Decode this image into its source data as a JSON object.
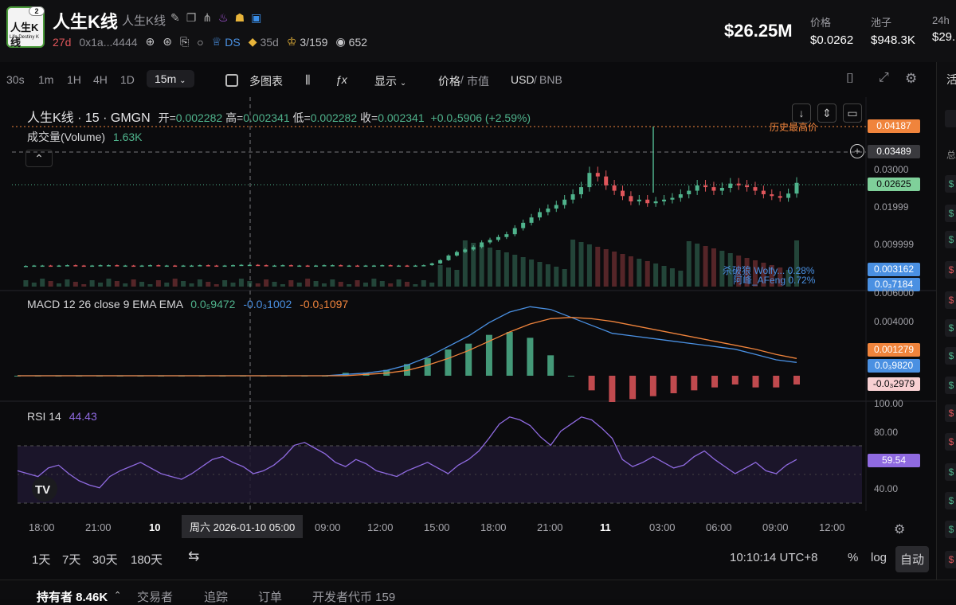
{
  "token": {
    "title": "人生K线",
    "subtitle": "人生K线",
    "logo_line1": "人生K线",
    "logo_line2": "Life Destiny K",
    "logo_badge": "2",
    "age": "27d",
    "address": "0x1a...4444",
    "ds_label": "DS",
    "holders_days": "35d",
    "top_ratio": "3/159",
    "views": "652"
  },
  "stats": {
    "market_cap": "$26.25M",
    "price_label": "价格",
    "price_value": "$0.0262",
    "pool_label": "池子",
    "pool_value": "$948.3K",
    "h24_label": "24h",
    "h24_value": "$29."
  },
  "toolbar": {
    "intervals": [
      "30s",
      "1m",
      "1H",
      "4H",
      "1D"
    ],
    "selected_interval": "15m",
    "multi_chart": "多图表",
    "display": "显示",
    "price_label": "价格",
    "mcap_label": "市值",
    "quote_a": "USD",
    "quote_b": "BNB"
  },
  "legend": {
    "symbol": "人生K线 · 15 · GMGN",
    "open_label": "开=",
    "open": "0.002282",
    "high_label": "高=",
    "high": "0.002341",
    "low_label": "低=",
    "low": "0.002282",
    "close_label": "收=",
    "close": "0.002341",
    "change": "+0.0₄5906 (+2.59%)",
    "volume_label": "成交量(Volume)",
    "volume_value": "1.63K",
    "macd_label": "MACD 12 26 close 9 EMA EMA",
    "macd_v1": "0.0₅9472",
    "macd_v2": "-0.0₃1002",
    "macd_v3": "-0.0₃1097",
    "rsi_label": "RSI 14",
    "rsi_value": "44.43"
  },
  "price_axis": {
    "ath_tag": "0.04187",
    "ath_label": "历史最高价",
    "crosshair_tag": "0.03489",
    "current_tag": "0.02625",
    "ticks": [
      "0.03000",
      "0.01999",
      "0.009999"
    ],
    "trader1": "杀破狼 Wolfy... 0.28%",
    "trader2": "阿峰_AFeng 0.72%",
    "tag_blue1": "0.003162",
    "tag_blue2": "0.0₃7184"
  },
  "macd_axis": {
    "ticks": [
      "0.006000",
      "0.004000"
    ],
    "tag_orange": "0.001279",
    "tag_blue": "0.0₃9820",
    "tag_red": "-0.0₃2979"
  },
  "rsi_axis": {
    "ticks": [
      "100.00",
      "80.00",
      "40.00"
    ],
    "tag": "59.54"
  },
  "time_axis": {
    "labels": [
      "18:00",
      "21:00",
      "10",
      "09:00",
      "12:00",
      "15:00",
      "18:00",
      "21:00",
      "11",
      "03:00",
      "06:00",
      "09:00",
      "12:00"
    ],
    "crosshair_label": "周六 2026-01-10  05:00"
  },
  "bottom": {
    "ranges": [
      "1天",
      "7天",
      "30天",
      "180天"
    ],
    "clock": "10:10:14 UTC+8",
    "percent": "%",
    "log": "log",
    "auto": "自动"
  },
  "footer_tabs": {
    "holders": "持有者 8.46K",
    "traders": "交易者",
    "tracking": "追踪",
    "orders": "订单",
    "dev_tokens": "开发者代币 159"
  },
  "side": {
    "tab": "活",
    "total": "总"
  },
  "chart_data": {
    "type": "candlestick",
    "price_series": [
      0.0029,
      0.0029,
      0.003,
      0.003,
      0.0029,
      0.003,
      0.0031,
      0.003,
      0.0029,
      0.003,
      0.0031,
      0.0031,
      0.003,
      0.003,
      0.0029,
      0.003,
      0.0031,
      0.003,
      0.003,
      0.0029,
      0.003,
      0.003,
      0.0031,
      0.003,
      0.0029,
      0.003,
      0.0031,
      0.0032,
      0.0032,
      0.0031,
      0.003,
      0.003,
      0.0031,
      0.003,
      0.003,
      0.0029,
      0.003,
      0.0031,
      0.0031,
      0.003,
      0.003,
      0.0029,
      0.003,
      0.003,
      0.0031,
      0.003,
      0.003,
      0.0029,
      0.003,
      0.0031,
      0.0036,
      0.0045,
      0.0058,
      0.0068,
      0.0075,
      0.0082,
      0.0095,
      0.0102,
      0.011,
      0.0118,
      0.0135,
      0.015,
      0.0165,
      0.018,
      0.019,
      0.02,
      0.0215,
      0.023,
      0.025,
      0.029,
      0.028,
      0.0255,
      0.024,
      0.0225,
      0.021,
      0.0215,
      0.0205,
      0.021,
      0.0215,
      0.022,
      0.023,
      0.024,
      0.0255,
      0.025,
      0.024,
      0.0248,
      0.026,
      0.0255,
      0.025,
      0.024,
      0.023,
      0.0225,
      0.022,
      0.0232,
      0.0262
    ],
    "rsi": [
      52,
      50,
      48,
      54,
      56,
      50,
      45,
      42,
      40,
      48,
      52,
      55,
      58,
      54,
      50,
      48,
      46,
      50,
      55,
      60,
      62,
      58,
      55,
      50,
      52,
      56,
      62,
      70,
      72,
      68,
      64,
      58,
      55,
      60,
      57,
      52,
      50,
      48,
      52,
      55,
      58,
      54,
      50,
      56,
      60,
      66,
      75,
      85,
      90,
      88,
      84,
      76,
      70,
      80,
      85,
      90,
      88,
      82,
      75,
      60,
      55,
      58,
      62,
      58,
      54,
      56,
      62,
      66,
      60,
      55,
      50,
      54,
      58,
      52,
      50,
      56,
      60
    ],
    "macd": [
      0,
      0,
      0,
      0,
      0,
      0,
      0,
      0,
      0,
      0,
      0,
      0,
      0,
      0,
      0,
      0,
      0.0001,
      0.0002,
      0.0004,
      0.0008,
      0.0014,
      0.0022,
      0.003,
      0.004,
      0.0048,
      0.0052,
      0.005,
      0.0044,
      0.0038,
      0.0032,
      0.003,
      0.0028,
      0.0026,
      0.0024,
      0.0022,
      0.002,
      0.0016,
      0.0012,
      0.001
    ],
    "signal": [
      0,
      0,
      0,
      0,
      0,
      0,
      0,
      0,
      0,
      0,
      0,
      0,
      0,
      0,
      0,
      0,
      0,
      0.0001,
      0.0002,
      0.0004,
      0.0008,
      0.0013,
      0.0019,
      0.0026,
      0.0033,
      0.0039,
      0.0043,
      0.0044,
      0.0043,
      0.0041,
      0.0038,
      0.0035,
      0.0032,
      0.0029,
      0.0026,
      0.0023,
      0.002,
      0.0016,
      0.0013
    ]
  },
  "colors": {
    "up": "#4fb38c",
    "down": "#e0565b",
    "accent": "#4a90e2",
    "orange": "#f0843c",
    "rsi": "#8f6ae0"
  }
}
